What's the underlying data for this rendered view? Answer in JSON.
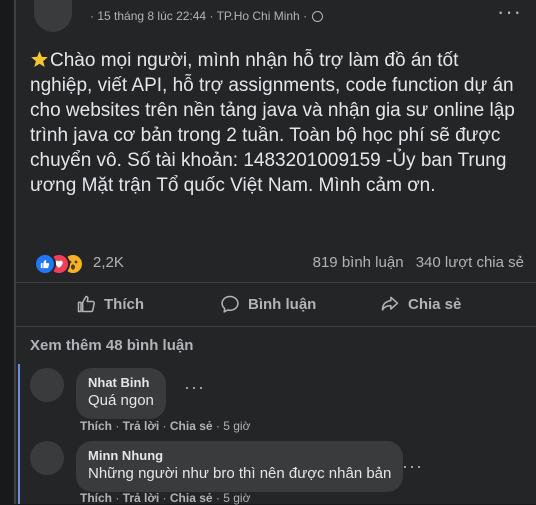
{
  "post": {
    "date": "15 tháng 8 lúc 22:44",
    "location": "TP.Ho Chi Minh",
    "separator": "·",
    "body": "Chào mọi người, mình nhận hỗ trợ làm đồ án tốt nghiệp, viết API, hỗ trợ assignments, code function dự án cho websites trên nền tảng java và nhận gia sư online lập trình java cơ bản trong 2 tuần. Toàn bộ học phí sẽ được chuyển vô. Số tài khoản: 1483201009159 -Ủy ban Trung ương Mặt trận Tổ quốc Việt Nam. Mình cảm ơn.",
    "reaction_count": "2,2K",
    "comment_count": "819 bình luận",
    "share_count": "340 lượt chia sẻ"
  },
  "actions": {
    "like": "Thích",
    "comment": "Bình luận",
    "share": "Chia sẻ"
  },
  "see_more": "Xem thêm 48 bình luận",
  "comments": [
    {
      "name": "Nhat Binh",
      "text": "Quá ngon",
      "like": "Thích",
      "reply": "Trả lời",
      "share": "Chia sẻ",
      "time": "5 giờ"
    },
    {
      "name": "Minn Nhung",
      "text": "Những người như bro thì nên được nhân bản",
      "like": "Thích",
      "reply": "Trả lời",
      "share": "Chia sẻ",
      "time": "5 giờ"
    }
  ],
  "colors": {
    "background": "#18191a",
    "card": "#242526",
    "bubble": "#3a3b3c",
    "text": "#e4e6eb",
    "secondary": "#b0b3b8",
    "like_blue": "#2078f4",
    "love_red": "#f33e58",
    "wow_yellow": "#f7b125"
  }
}
